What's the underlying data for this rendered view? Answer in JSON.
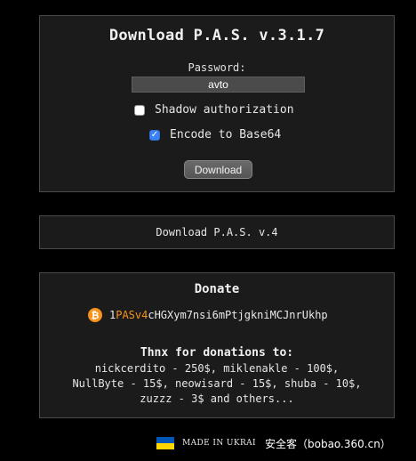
{
  "download_panel": {
    "title": "Download P.A.S. v.3.1.7",
    "password_label": "Password:",
    "password_value": "avto",
    "shadow_auth_label": "Shadow authorization",
    "shadow_auth_checked": false,
    "encode_base64_label": "Encode to Base64",
    "encode_base64_checked": true,
    "download_button_label": "Download"
  },
  "v4_panel": {
    "link_label": "Download P.A.S. v.4"
  },
  "donate_panel": {
    "title": "Donate",
    "bitcoin_icon": "bitcoin-icon",
    "bitcoin_icon_glyph": "₿",
    "address_prefix": "1",
    "address_highlight": "PASv4",
    "address_rest": "cHGXym7nsi6mPtjgkniMCJnrUkhp",
    "thanks_title": "Thnx for donations to:",
    "donor_lines": [
      "nickcerdito - 250$, miklenakle - 100$,",
      "NullByte - 15$, neowisard - 15$, shuba - 10$,",
      "zuzzz - 3$ and others..."
    ]
  },
  "footer": {
    "flag_icon": "ukraine-flag-icon",
    "text": "MADE IN UKRAI"
  },
  "watermark": {
    "text": "安全客（bobao.360.cn）"
  },
  "colors": {
    "background": "#000000",
    "panel": "#1b1b1b",
    "panel_border": "#4a4a4a",
    "accent_orange": "#f7931a",
    "checkbox_blue": "#3b82f6"
  }
}
